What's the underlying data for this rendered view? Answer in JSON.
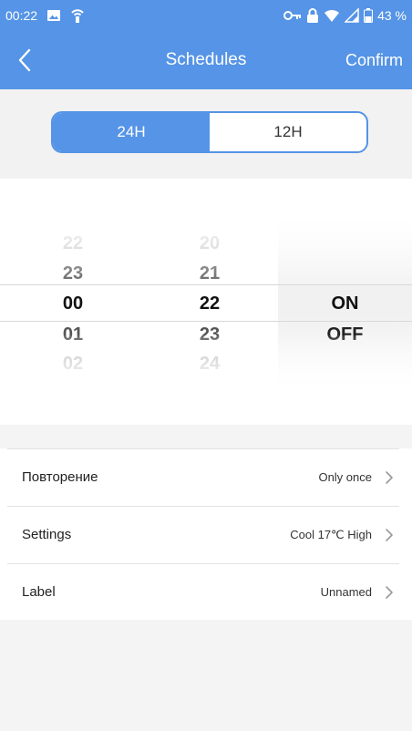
{
  "status_bar": {
    "time": "00:22",
    "battery": "43 %",
    "icons": [
      "gallery-icon",
      "wifi-tether-icon",
      "key-icon",
      "lock-icon",
      "wifi-icon",
      "signal-icon",
      "battery-icon"
    ]
  },
  "header": {
    "title": "Schedules",
    "confirm_label": "Confirm",
    "back_icon": "chevron-left-icon"
  },
  "time_format": {
    "options": [
      "24H",
      "12H"
    ],
    "selected": "24H"
  },
  "picker": {
    "hours": [
      "22",
      "23",
      "00",
      "01",
      "02"
    ],
    "minutes": [
      "20",
      "21",
      "22",
      "23",
      "24"
    ],
    "states": [
      "ON",
      "OFF"
    ]
  },
  "settings": [
    {
      "label": "Повторение",
      "value": "Only once"
    },
    {
      "label": "Settings",
      "value": "Cool 17℃ High"
    },
    {
      "label": "Label",
      "value": "Unnamed"
    }
  ],
  "colors": {
    "primary": "#5594e6",
    "background_band": "#f2f2f2",
    "text_dark": "#222222"
  }
}
